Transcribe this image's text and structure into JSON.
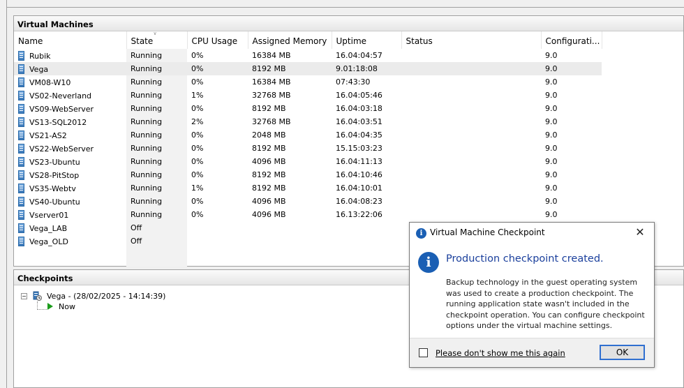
{
  "vm_panel": {
    "title": "Virtual Machines",
    "columns": [
      "Name",
      "State",
      "CPU Usage",
      "Assigned Memory",
      "Uptime",
      "Status",
      "Configurati..."
    ],
    "rows": [
      {
        "name": "Rubik",
        "state": "Running",
        "cpu": "0%",
        "memory": "16384 MB",
        "uptime": "16.04:04:57",
        "status": "",
        "config": "9.0"
      },
      {
        "name": "Vega",
        "state": "Running",
        "cpu": "0%",
        "memory": "8192 MB",
        "uptime": "9.01:18:08",
        "status": "",
        "config": "9.0"
      },
      {
        "name": "VM08-W10",
        "state": "Running",
        "cpu": "0%",
        "memory": "16384 MB",
        "uptime": "07:43:30",
        "status": "",
        "config": "9.0"
      },
      {
        "name": "VS02-Neverland",
        "state": "Running",
        "cpu": "1%",
        "memory": "32768 MB",
        "uptime": "16.04:05:46",
        "status": "",
        "config": "9.0"
      },
      {
        "name": "VS09-WebServer",
        "state": "Running",
        "cpu": "0%",
        "memory": "8192 MB",
        "uptime": "16.04:03:18",
        "status": "",
        "config": "9.0"
      },
      {
        "name": "VS13-SQL2012",
        "state": "Running",
        "cpu": "2%",
        "memory": "32768 MB",
        "uptime": "16.04:03:51",
        "status": "",
        "config": "9.0"
      },
      {
        "name": "VS21-AS2",
        "state": "Running",
        "cpu": "0%",
        "memory": "2048 MB",
        "uptime": "16.04:04:35",
        "status": "",
        "config": "9.0"
      },
      {
        "name": "VS22-WebServer",
        "state": "Running",
        "cpu": "0%",
        "memory": "8192 MB",
        "uptime": "15.15:03:23",
        "status": "",
        "config": "9.0"
      },
      {
        "name": "VS23-Ubuntu",
        "state": "Running",
        "cpu": "0%",
        "memory": "4096 MB",
        "uptime": "16.04:11:13",
        "status": "",
        "config": "9.0"
      },
      {
        "name": "VS28-PitStop",
        "state": "Running",
        "cpu": "0%",
        "memory": "8192 MB",
        "uptime": "16.04:10:46",
        "status": "",
        "config": "9.0"
      },
      {
        "name": "VS35-Webtv",
        "state": "Running",
        "cpu": "1%",
        "memory": "8192 MB",
        "uptime": "16.04:10:01",
        "status": "",
        "config": "9.0"
      },
      {
        "name": "VS40-Ubuntu",
        "state": "Running",
        "cpu": "0%",
        "memory": "4096 MB",
        "uptime": "16.04:08:23",
        "status": "",
        "config": "9.0"
      },
      {
        "name": "Vserver01",
        "state": "Running",
        "cpu": "0%",
        "memory": "4096 MB",
        "uptime": "16.13:22:06",
        "status": "",
        "config": "9.0"
      },
      {
        "name": "Vega_LAB",
        "state": "Off",
        "cpu": "",
        "memory": "",
        "uptime": "",
        "status": "",
        "config": ""
      },
      {
        "name": "Vega_OLD",
        "state": "Off",
        "cpu": "",
        "memory": "",
        "uptime": "",
        "status": "",
        "config": ""
      }
    ],
    "selected_row": "Vega"
  },
  "cp_panel": {
    "title": "Checkpoints",
    "node_label": "Vega - (28/02/2025 - 14:14:39)",
    "now_label": "Now"
  },
  "dialog": {
    "title": "Virtual Machine Checkpoint",
    "heading": "Production checkpoint created.",
    "body": "Backup technology in the guest operating system was used to create a production checkpoint. The running application state wasn't included in the checkpoint operation. You can configure checkpoint options under the virtual machine settings.",
    "checkbox_label": "Please don't show me this again",
    "checkbox_checked": false,
    "ok_label": "OK",
    "close_glyph": "✕"
  },
  "colors": {
    "heading_blue": "#1a3f9c",
    "info_icon_blue": "#1a5fb4",
    "ok_border": "#2f6fd0",
    "now_play_green": "#1c9c1c"
  }
}
